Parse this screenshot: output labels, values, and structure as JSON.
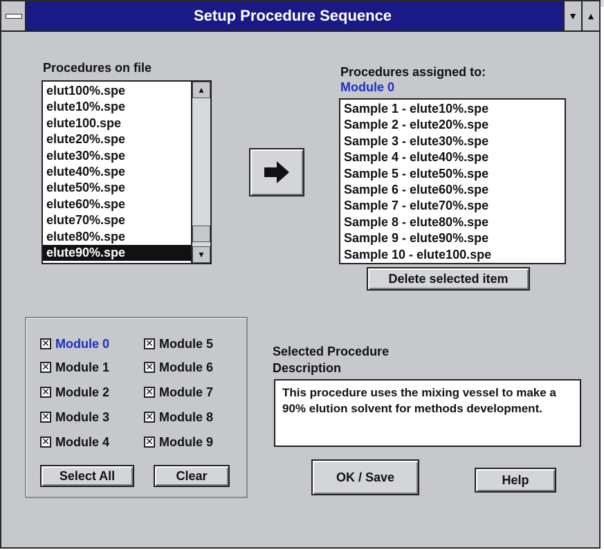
{
  "window": {
    "title": "Setup Procedure Sequence"
  },
  "left_list": {
    "label": "Procedures on file",
    "items": [
      "elut100%.spe",
      "elute10%.spe",
      "elute100.spe",
      "elute20%.spe",
      "elute30%.spe",
      "elute40%.spe",
      "elute50%.spe",
      "elute60%.spe",
      "elute70%.spe",
      "elute80%.spe",
      "elute90%.spe"
    ],
    "selected_index": 10
  },
  "right_list": {
    "label": "Procedures assigned to:",
    "module": "Module 0",
    "items": [
      "Sample 1 - elute10%.spe",
      "Sample 2 - elute20%.spe",
      "Sample 3 - elute30%.spe",
      "Sample 4 - elute40%.spe",
      "Sample 5 - elute50%.spe",
      "Sample 6 - elute60%.spe",
      "Sample 7 - elute70%.spe",
      "Sample 8 - elute80%.spe",
      "Sample 9 - elute90%.spe",
      "Sample 10 - elute100.spe"
    ]
  },
  "buttons": {
    "assign_icon": "right-arrow-icon",
    "delete": "Delete selected item",
    "select_all": "Select All",
    "clear": "Clear",
    "ok_save": "OK / Save",
    "help": "Help"
  },
  "modules": [
    {
      "label": "Module 0",
      "checked": true,
      "active": true
    },
    {
      "label": "Module 1",
      "checked": true
    },
    {
      "label": "Module 2",
      "checked": true
    },
    {
      "label": "Module 3",
      "checked": true
    },
    {
      "label": "Module 4",
      "checked": true
    },
    {
      "label": "Module 5",
      "checked": true
    },
    {
      "label": "Module 6",
      "checked": true
    },
    {
      "label": "Module 7",
      "checked": true
    },
    {
      "label": "Module 8",
      "checked": true
    },
    {
      "label": "Module 9",
      "checked": true
    }
  ],
  "description": {
    "label_line1": "Selected Procedure",
    "label_line2": "Description",
    "text": "This procedure uses the mixing vessel to make a 90% elution solvent for methods development."
  },
  "colors": {
    "titlebar": "#1a1a86",
    "accent": "#1a2fc8",
    "window": "#c6c8cc"
  }
}
